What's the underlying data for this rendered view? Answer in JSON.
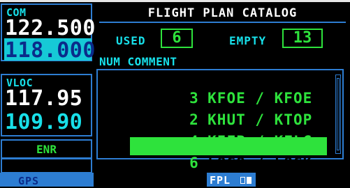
{
  "radio": {
    "com_label": "COM",
    "com_active": "122.500",
    "com_standby": "118.000",
    "vloc_label": "VLOC",
    "vloc_active": "117.95",
    "vloc_standby": "109.90",
    "cdi_mode": "ENR"
  },
  "page": {
    "title": "FLIGHT PLAN CATALOG",
    "used_label": "USED",
    "used_value": "6",
    "empty_label": "EMPTY",
    "empty_value": "13",
    "header": "NUM COMMENT"
  },
  "flight_plans": [
    {
      "num": "3",
      "comment": "KFOE / KFOE"
    },
    {
      "num": "2",
      "comment": "KHUT / KTOP"
    },
    {
      "num": "4",
      "comment": "KIFP / KFLG"
    },
    {
      "num": "6",
      "comment": "LOGO / LOGK"
    }
  ],
  "status_bar": {
    "mode": "GPS",
    "page_group": "FPL"
  },
  "colors": {
    "cyan": "#17e0ea",
    "green": "#2ee23c",
    "blue_border": "#2d7dd2"
  }
}
